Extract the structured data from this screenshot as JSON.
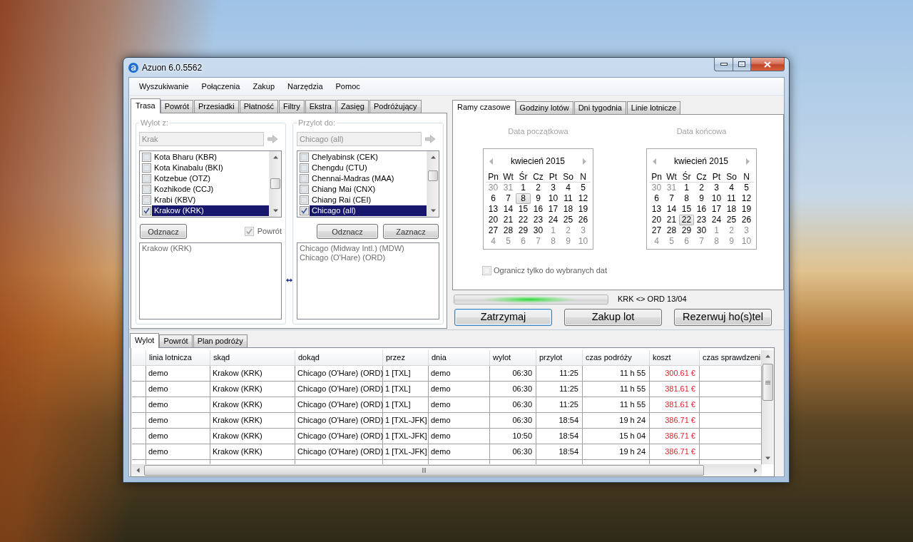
{
  "window": {
    "title": "Azuon 6.0.5562"
  },
  "menu": [
    {
      "label": "Wyszukiwanie"
    },
    {
      "label": "Połączenia"
    },
    {
      "label": "Zakup"
    },
    {
      "label": "Narzędzia"
    },
    {
      "label": "Pomoc"
    }
  ],
  "route_panel": {
    "tabs": [
      {
        "label": "Trasa",
        "selected": true
      },
      {
        "label": "Powrót",
        "selected": false
      },
      {
        "label": "Przesiadki",
        "selected": false
      },
      {
        "label": "Płatność",
        "selected": false
      },
      {
        "label": "Filtry",
        "selected": false
      },
      {
        "label": "Ekstra",
        "selected": false
      },
      {
        "label": "Zasięg",
        "selected": false
      },
      {
        "label": "Podróżujący",
        "selected": false
      }
    ],
    "groups": [
      {
        "legend": "Wylot z:",
        "search": {
          "value": "Krak",
          "disabled": true
        },
        "airports": [
          {
            "label": "Kota Bharu (KBR)",
            "checked": false,
            "selected": false
          },
          {
            "label": "Kota Kinabalu (BKI)",
            "checked": false,
            "selected": false
          },
          {
            "label": "Kotzebue (OTZ)",
            "checked": false,
            "selected": false
          },
          {
            "label": "Kozhikode (CCJ)",
            "checked": false,
            "selected": false
          },
          {
            "label": "Krabi (KBV)",
            "checked": false,
            "selected": false
          },
          {
            "label": "Krakow (KRK)",
            "checked": true,
            "selected": true
          }
        ],
        "controls": [
          {
            "kind": "button",
            "label": "Odznacz"
          },
          {
            "kind": "checkbox",
            "label": "Powrót",
            "checked": true,
            "disabled": true
          }
        ],
        "chosen": [
          "Krakow (KRK)"
        ]
      },
      {
        "legend": "Przylot do:",
        "search": {
          "value": "Chicago (all)",
          "disabled": true
        },
        "airports": [
          {
            "label": "Chelyabinsk (CEK)",
            "checked": false,
            "selected": false
          },
          {
            "label": "Chengdu (CTU)",
            "checked": false,
            "selected": false
          },
          {
            "label": "Chennai-Madras (MAA)",
            "checked": false,
            "selected": false
          },
          {
            "label": "Chiang Mai (CNX)",
            "checked": false,
            "selected": false
          },
          {
            "label": "Chiang Rai (CEI)",
            "checked": false,
            "selected": false
          },
          {
            "label": "Chicago (all)",
            "checked": true,
            "selected": true
          }
        ],
        "controls": [
          {
            "kind": "button",
            "label": "Odznacz"
          },
          {
            "kind": "button",
            "label": "Zaznacz"
          }
        ],
        "chosen": [
          "Chicago (Midway Intl.) (MDW)",
          "Chicago (O'Hare) (ORD)"
        ]
      }
    ]
  },
  "time_panel": {
    "tabs": [
      {
        "label": "Ramy czasowe",
        "selected": true
      },
      {
        "label": "Godziny lotów",
        "selected": false
      },
      {
        "label": "Dni tygodnia",
        "selected": false
      },
      {
        "label": "Linie lotnicze",
        "selected": false
      }
    ],
    "calendars": [
      {
        "caption": "Data początkowa",
        "month": "kwiecień 2015",
        "weekdays": [
          "Pn",
          "Wt",
          "Śr",
          "Cz",
          "Pt",
          "So",
          "N"
        ],
        "weeks": [
          [
            {
              "day": "30",
              "other_month": true,
              "selected": false
            },
            {
              "day": "31",
              "other_month": true,
              "selected": false
            },
            {
              "day": "1",
              "other_month": false,
              "selected": false
            },
            {
              "day": "2",
              "other_month": false,
              "selected": false
            },
            {
              "day": "3",
              "other_month": false,
              "selected": false
            },
            {
              "day": "4",
              "other_month": false,
              "selected": false
            },
            {
              "day": "5",
              "other_month": false,
              "selected": false
            }
          ],
          [
            {
              "day": "6",
              "other_month": false,
              "selected": false
            },
            {
              "day": "7",
              "other_month": false,
              "selected": false
            },
            {
              "day": "8",
              "other_month": false,
              "selected": true
            },
            {
              "day": "9",
              "other_month": false,
              "selected": false
            },
            {
              "day": "10",
              "other_month": false,
              "selected": false
            },
            {
              "day": "11",
              "other_month": false,
              "selected": false
            },
            {
              "day": "12",
              "other_month": false,
              "selected": false
            }
          ],
          [
            {
              "day": "13",
              "other_month": false,
              "selected": false
            },
            {
              "day": "14",
              "other_month": false,
              "selected": false
            },
            {
              "day": "15",
              "other_month": false,
              "selected": false
            },
            {
              "day": "16",
              "other_month": false,
              "selected": false
            },
            {
              "day": "17",
              "other_month": false,
              "selected": false
            },
            {
              "day": "18",
              "other_month": false,
              "selected": false
            },
            {
              "day": "19",
              "other_month": false,
              "selected": false
            }
          ],
          [
            {
              "day": "20",
              "other_month": false,
              "selected": false
            },
            {
              "day": "21",
              "other_month": false,
              "selected": false
            },
            {
              "day": "22",
              "other_month": false,
              "selected": false
            },
            {
              "day": "23",
              "other_month": false,
              "selected": false
            },
            {
              "day": "24",
              "other_month": false,
              "selected": false
            },
            {
              "day": "25",
              "other_month": false,
              "selected": false
            },
            {
              "day": "26",
              "other_month": false,
              "selected": false
            }
          ],
          [
            {
              "day": "27",
              "other_month": false,
              "selected": false
            },
            {
              "day": "28",
              "other_month": false,
              "selected": false
            },
            {
              "day": "29",
              "other_month": false,
              "selected": false
            },
            {
              "day": "30",
              "other_month": false,
              "selected": false
            },
            {
              "day": "1",
              "other_month": true,
              "selected": false
            },
            {
              "day": "2",
              "other_month": true,
              "selected": false
            },
            {
              "day": "3",
              "other_month": true,
              "selected": false
            }
          ],
          [
            {
              "day": "4",
              "other_month": true,
              "selected": false
            },
            {
              "day": "5",
              "other_month": true,
              "selected": false
            },
            {
              "day": "6",
              "other_month": true,
              "selected": false
            },
            {
              "day": "7",
              "other_month": true,
              "selected": false
            },
            {
              "day": "8",
              "other_month": true,
              "selected": false
            },
            {
              "day": "9",
              "other_month": true,
              "selected": false
            },
            {
              "day": "10",
              "other_month": true,
              "selected": false
            }
          ]
        ]
      },
      {
        "caption": "Data końcowa",
        "month": "kwiecień 2015",
        "weekdays": [
          "Pn",
          "Wt",
          "Śr",
          "Cz",
          "Pt",
          "So",
          "N"
        ],
        "weeks": [
          [
            {
              "day": "30",
              "other_month": true,
              "selected": false
            },
            {
              "day": "31",
              "other_month": true,
              "selected": false
            },
            {
              "day": "1",
              "other_month": false,
              "selected": false
            },
            {
              "day": "2",
              "other_month": false,
              "selected": false
            },
            {
              "day": "3",
              "other_month": false,
              "selected": false
            },
            {
              "day": "4",
              "other_month": false,
              "selected": false
            },
            {
              "day": "5",
              "other_month": false,
              "selected": false
            }
          ],
          [
            {
              "day": "6",
              "other_month": false,
              "selected": false
            },
            {
              "day": "7",
              "other_month": false,
              "selected": false
            },
            {
              "day": "8",
              "other_month": false,
              "selected": false
            },
            {
              "day": "9",
              "other_month": false,
              "selected": false
            },
            {
              "day": "10",
              "other_month": false,
              "selected": false
            },
            {
              "day": "11",
              "other_month": false,
              "selected": false
            },
            {
              "day": "12",
              "other_month": false,
              "selected": false
            }
          ],
          [
            {
              "day": "13",
              "other_month": false,
              "selected": false
            },
            {
              "day": "14",
              "other_month": false,
              "selected": false
            },
            {
              "day": "15",
              "other_month": false,
              "selected": false
            },
            {
              "day": "16",
              "other_month": false,
              "selected": false
            },
            {
              "day": "17",
              "other_month": false,
              "selected": false
            },
            {
              "day": "18",
              "other_month": false,
              "selected": false
            },
            {
              "day": "19",
              "other_month": false,
              "selected": false
            }
          ],
          [
            {
              "day": "20",
              "other_month": false,
              "selected": false
            },
            {
              "day": "21",
              "other_month": false,
              "selected": false
            },
            {
              "day": "22",
              "other_month": false,
              "selected": true
            },
            {
              "day": "23",
              "other_month": false,
              "selected": false
            },
            {
              "day": "24",
              "other_month": false,
              "selected": false
            },
            {
              "day": "25",
              "other_month": false,
              "selected": false
            },
            {
              "day": "26",
              "other_month": false,
              "selected": false
            }
          ],
          [
            {
              "day": "27",
              "other_month": false,
              "selected": false
            },
            {
              "day": "28",
              "other_month": false,
              "selected": false
            },
            {
              "day": "29",
              "other_month": false,
              "selected": false
            },
            {
              "day": "30",
              "other_month": false,
              "selected": false
            },
            {
              "day": "1",
              "other_month": true,
              "selected": false
            },
            {
              "day": "2",
              "other_month": true,
              "selected": false
            },
            {
              "day": "3",
              "other_month": true,
              "selected": false
            }
          ],
          [
            {
              "day": "4",
              "other_month": true,
              "selected": false
            },
            {
              "day": "5",
              "other_month": true,
              "selected": false
            },
            {
              "day": "6",
              "other_month": true,
              "selected": false
            },
            {
              "day": "7",
              "other_month": true,
              "selected": false
            },
            {
              "day": "8",
              "other_month": true,
              "selected": false
            },
            {
              "day": "9",
              "other_month": true,
              "selected": false
            },
            {
              "day": "10",
              "other_month": true,
              "selected": false
            }
          ]
        ]
      }
    ],
    "limit_checkbox": {
      "label": "Ogranicz tylko do wybranych dat",
      "checked": false,
      "disabled": true
    }
  },
  "progress": {
    "indeterminate": true,
    "label": "KRK <> ORD 13/04"
  },
  "actions": [
    {
      "label": "Zatrzymaj",
      "focused": true
    },
    {
      "label": "Zakup lot",
      "focused": false
    },
    {
      "label": "Rezerwuj ho(s)tel",
      "focused": false
    }
  ],
  "results": {
    "tabs": [
      {
        "label": "Wylot",
        "selected": true
      },
      {
        "label": "Powrót",
        "selected": false
      },
      {
        "label": "Plan podróży",
        "selected": false
      }
    ],
    "columns": [
      {
        "label": "linia lotnicza",
        "kind": "text"
      },
      {
        "label": "skąd",
        "kind": "text"
      },
      {
        "label": "dokąd",
        "kind": "text"
      },
      {
        "label": "przez",
        "kind": "text"
      },
      {
        "label": "dnia",
        "kind": "text"
      },
      {
        "label": "wylot",
        "kind": "time"
      },
      {
        "label": "przylot",
        "kind": "time"
      },
      {
        "label": "czas podróży",
        "kind": "duration"
      },
      {
        "label": "koszt",
        "kind": "price"
      },
      {
        "label": "czas sprawdzeni",
        "kind": "text"
      }
    ],
    "rows": [
      [
        "demo",
        "Krakow (KRK)",
        "Chicago (O'Hare) (ORD)",
        "1 [TXL]",
        "demo",
        "06:30",
        "11:25",
        "11 h 55",
        "300.61 €"
      ],
      [
        "demo",
        "Krakow (KRK)",
        "Chicago (O'Hare) (ORD)",
        "1 [TXL]",
        "demo",
        "06:30",
        "11:25",
        "11 h 55",
        "381.61 €"
      ],
      [
        "demo",
        "Krakow (KRK)",
        "Chicago (O'Hare) (ORD)",
        "1 [TXL]",
        "demo",
        "06:30",
        "11:25",
        "11 h 55",
        "381.61 €"
      ],
      [
        "demo",
        "Krakow (KRK)",
        "Chicago (O'Hare) (ORD)",
        "1 [TXL-JFK]",
        "demo",
        "06:30",
        "18:54",
        "19 h 24",
        "386.71 €"
      ],
      [
        "demo",
        "Krakow (KRK)",
        "Chicago (O'Hare) (ORD)",
        "1 [TXL-JFK]",
        "demo",
        "10:50",
        "18:54",
        "15 h 04",
        "386.71 €"
      ],
      [
        "demo",
        "Krakow (KRK)",
        "Chicago (O'Hare) (ORD)",
        "1 [TXL-JFK]",
        "demo",
        "06:30",
        "18:54",
        "19 h 24",
        "386.71 €"
      ]
    ]
  }
}
